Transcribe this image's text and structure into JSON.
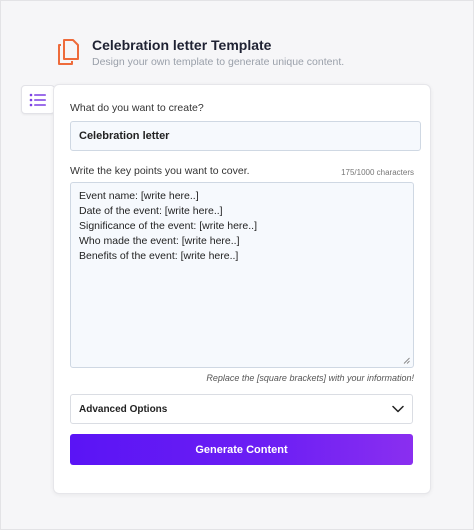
{
  "header": {
    "title": "Celebration letter Template",
    "subtitle": "Design your own template to generate unique content.",
    "icon": "document-copy-icon",
    "icon_color": "#ee6b3b"
  },
  "menu_button": {
    "icon": "list-icon",
    "icon_color": "#7b3fe4"
  },
  "form": {
    "create_label": "What do you want to create?",
    "create_value": "Celebration letter",
    "keypoints_label": "Write the key points you want to cover.",
    "char_counter": "175/1000 characters",
    "keypoints_lines": [
      "Event name: [write here..]",
      "Date of the event: [write here..]",
      "Significance of the event: [write here..]",
      "Who made the event: [write here..]",
      "Benefits of the event: [write here..]"
    ],
    "hint": "Replace the [square brackets] with your information!",
    "advanced_label": "Advanced Options",
    "generate_label": "Generate Content"
  },
  "colors": {
    "accent_start": "#5a14f5",
    "accent_end": "#8a2ff0",
    "field_bg": "#f6f9fd"
  }
}
